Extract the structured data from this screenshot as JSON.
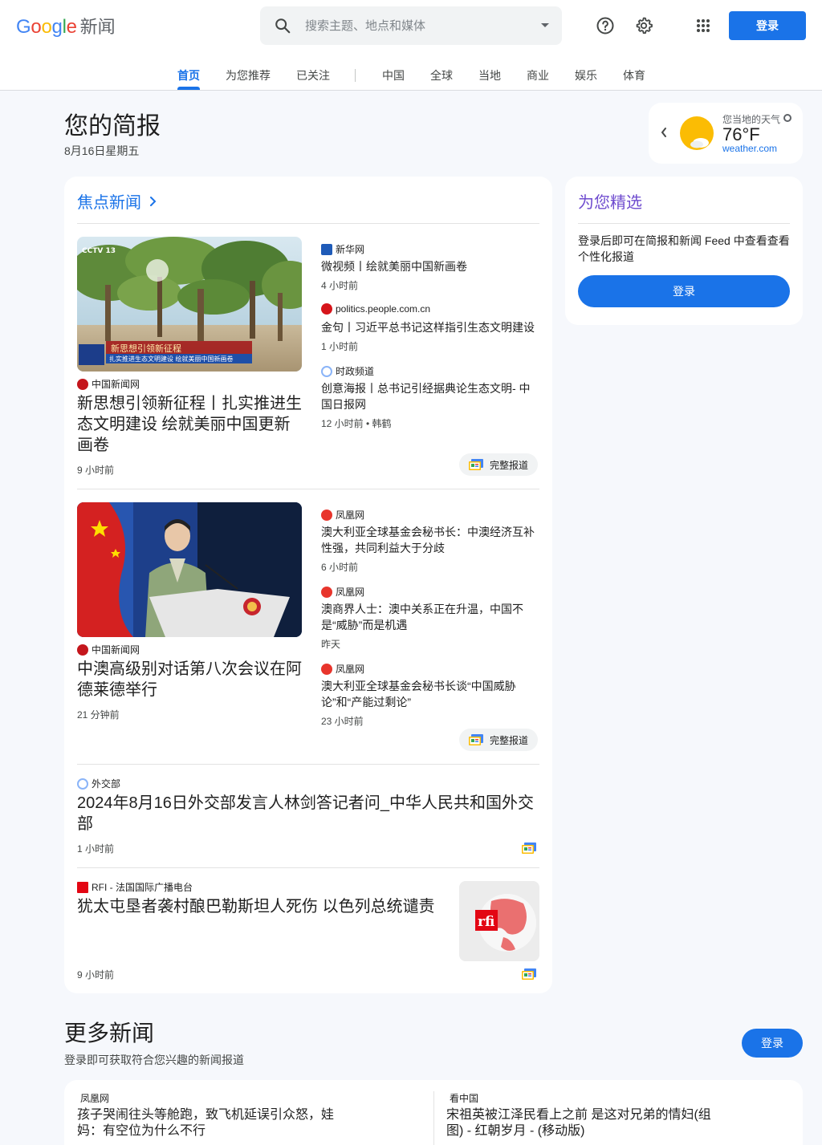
{
  "header": {
    "logo_google": "Google",
    "logo_news": "新闻",
    "search_placeholder": "搜索主题、地点和媒体",
    "signin": "登录"
  },
  "nav": {
    "tabs": [
      "首页",
      "为您推荐",
      "已关注",
      "中国",
      "全球",
      "当地",
      "商业",
      "娱乐",
      "体育"
    ]
  },
  "briefing": {
    "title": "您的简报",
    "date": "8月16日星期五"
  },
  "weather": {
    "label": "您当地的天气",
    "temp": "76°F",
    "source": "weather.com"
  },
  "top_stories": {
    "heading": "焦点新闻",
    "full_coverage": "完整报道",
    "cluster1": {
      "main": {
        "source": "中国新闻网",
        "title": "新思想引领新征程丨扎实推进生态文明建设 绘就美丽中国更新画卷",
        "time": "9 小时前",
        "image_caption": "新思想引领新征程",
        "image_subcaption": "扎实推进生态文明建设 绘就美丽中国新画卷",
        "image_logo": "CCTV 13"
      },
      "related": [
        {
          "source": "新华网",
          "title": "微视频丨绘就美丽中国新画卷",
          "time": "4 小时前"
        },
        {
          "source": "politics.people.com.cn",
          "title": "金句丨习近平总书记这样指引生态文明建设",
          "time": "1 小时前"
        },
        {
          "source": "时政频道",
          "title": "创意海报丨总书记引经据典论生态文明- 中国日报网",
          "time": "12 小时前 • 韩鹤"
        }
      ]
    },
    "cluster2": {
      "main": {
        "source": "中国新闻网",
        "title": "中澳高级别对话第八次会议在阿德莱德举行",
        "time": "21 分钟前"
      },
      "related": [
        {
          "source": "凤凰网",
          "title": "澳大利亚全球基金会秘书长：中澳经济互补性强，共同利益大于分歧",
          "time": "6 小时前"
        },
        {
          "source": "凤凰网",
          "title": "澳商界人士：澳中关系正在升温，中国不是“威胁”而是机遇",
          "time": "昨天"
        },
        {
          "source": "凤凰网",
          "title": "澳大利亚全球基金会秘书长谈“中国威胁论”和“产能过剩论”",
          "time": "23 小时前"
        }
      ]
    },
    "story3": {
      "source": "外交部",
      "title": "2024年8月16日外交部发言人林剑答记者问_中华人民共和国外交部",
      "time": "1 小时前"
    },
    "story4": {
      "source": "RFI - 法国国际广播电台",
      "title": "犹太屯垦者袭村酿巴勒斯坦人死伤 以色列总统谴责",
      "time": "9 小时前",
      "thumb_logo": "rfi"
    }
  },
  "picks": {
    "title": "为您精选",
    "text": "登录后即可在简报和新闻 Feed 中查看查看个性化报道",
    "button": "登录"
  },
  "more_news": {
    "title": "更多新闻",
    "subtitle": "登录即可获取符合您兴趣的新闻报道",
    "button": "登录",
    "items": [
      {
        "source": "凤凰网",
        "title": "孩子哭闹往头等舱跑，致飞机延误引众怒，娃妈：有空位为什么不行"
      },
      {
        "source": "看中国",
        "title": "宋祖英被江泽民看上之前 是这对兄弟的情妇(组图) - 红朝岁月 - (移动版)"
      }
    ]
  },
  "colors": {
    "accent": "#1a73e8",
    "picks_title": "#6f4ccf",
    "background": "#f6f8fc"
  }
}
